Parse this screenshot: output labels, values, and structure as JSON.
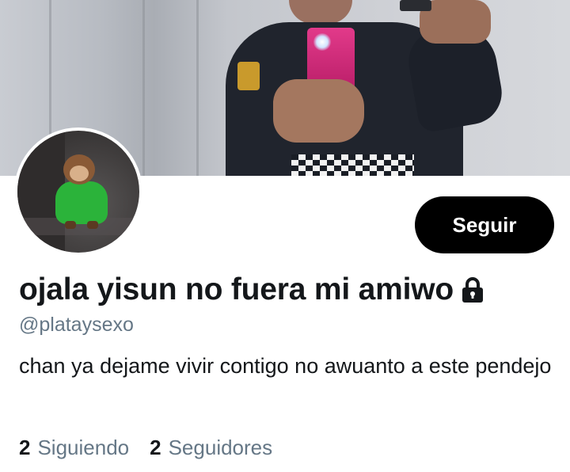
{
  "profile": {
    "display_name": "ojala yisun no fuera mi amiwo",
    "handle": "@plataysexo",
    "bio": "chan ya dejame vivir contigo no awuanto a este pendejo",
    "protected_icon": "lock-icon"
  },
  "actions": {
    "follow_label": "Seguir"
  },
  "stats": {
    "following_count": "2",
    "following_label": "Siguiendo",
    "followers_count": "2",
    "followers_label": "Seguidores"
  },
  "colors": {
    "text_primary": "#14171a",
    "text_secondary": "#657786",
    "button_bg": "#000000",
    "button_text": "#ffffff",
    "background": "#ffffff"
  }
}
